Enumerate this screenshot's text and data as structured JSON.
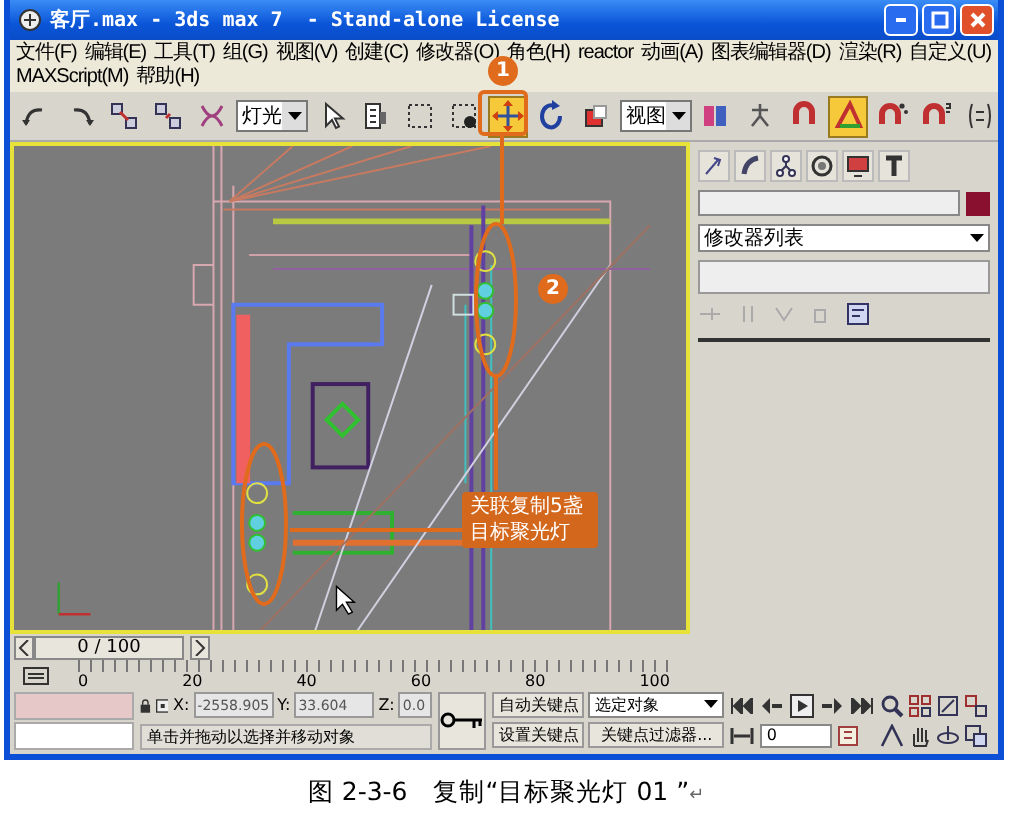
{
  "window": {
    "title": "客厅.max - 3ds max 7  - Stand-alone License"
  },
  "menu": [
    "文件(F)",
    "编辑(E)",
    "工具(T)",
    "组(G)",
    "视图(V)",
    "创建(C)",
    "修改器(O)",
    "角色(H)",
    "reactor",
    "动画(A)",
    "图表编辑器(D)",
    "渲染(R)",
    "自定义(U)",
    "MAXScript(M)",
    "帮助(H)"
  ],
  "toolbar": [
    {
      "kind": "undo",
      "selected": false
    },
    {
      "kind": "redo",
      "selected": false
    },
    {
      "kind": "link",
      "selected": false
    },
    {
      "kind": "unlink",
      "selected": false
    },
    {
      "kind": "bind",
      "selected": false
    },
    {
      "kind": "dropdown",
      "value": "灯光"
    },
    {
      "kind": "select",
      "selected": false
    },
    {
      "kind": "select-by-name",
      "selected": false
    },
    {
      "kind": "region",
      "selected": false
    },
    {
      "kind": "crossing",
      "selected": false
    },
    {
      "kind": "move",
      "selected": true
    },
    {
      "kind": "rotate",
      "selected": false
    },
    {
      "kind": "scale",
      "selected": false
    },
    {
      "kind": "dropdown",
      "value": "视图"
    },
    {
      "kind": "pivot",
      "selected": false
    },
    {
      "kind": "manipulate",
      "selected": false
    },
    {
      "kind": "snap",
      "selected": false
    },
    {
      "kind": "angle-snap",
      "selected": true
    },
    {
      "kind": "percent-snap",
      "selected": false
    },
    {
      "kind": "spinner-snap",
      "selected": false
    },
    {
      "kind": "named-sets",
      "selected": false
    }
  ],
  "annotations": [
    {
      "kind": "marker",
      "text": "1"
    },
    {
      "kind": "marker",
      "text": "2"
    },
    {
      "kind": "callout",
      "text": "关联复制5盏目标聚光灯"
    }
  ],
  "command_panel": {
    "modifier_list": "修改器列表",
    "object_swatch": {
      "color": "#8a1030"
    }
  },
  "time_slider": {
    "label": "0 / 100",
    "level": 0
  },
  "ruler_labels": [
    "0",
    "20",
    "40",
    "60",
    "80",
    "100"
  ],
  "status": {
    "coordinates": [
      {
        "label": "X:",
        "value": "-2558.905"
      },
      {
        "label": "Y:",
        "value": "33.604"
      },
      {
        "label": "Z:",
        "value": "0.0"
      }
    ],
    "prompt": "单击并拖动以选择并移动对象",
    "auto_key": "自动关键点",
    "set_key": "设置关键点",
    "key_mode": "选定对象",
    "key_filters": "关键点过滤器...",
    "frame": "0"
  },
  "caption": {
    "text": "图 2-3-6　复制“目标聚光灯 01 ”",
    "paragraph_mark": "↵"
  }
}
